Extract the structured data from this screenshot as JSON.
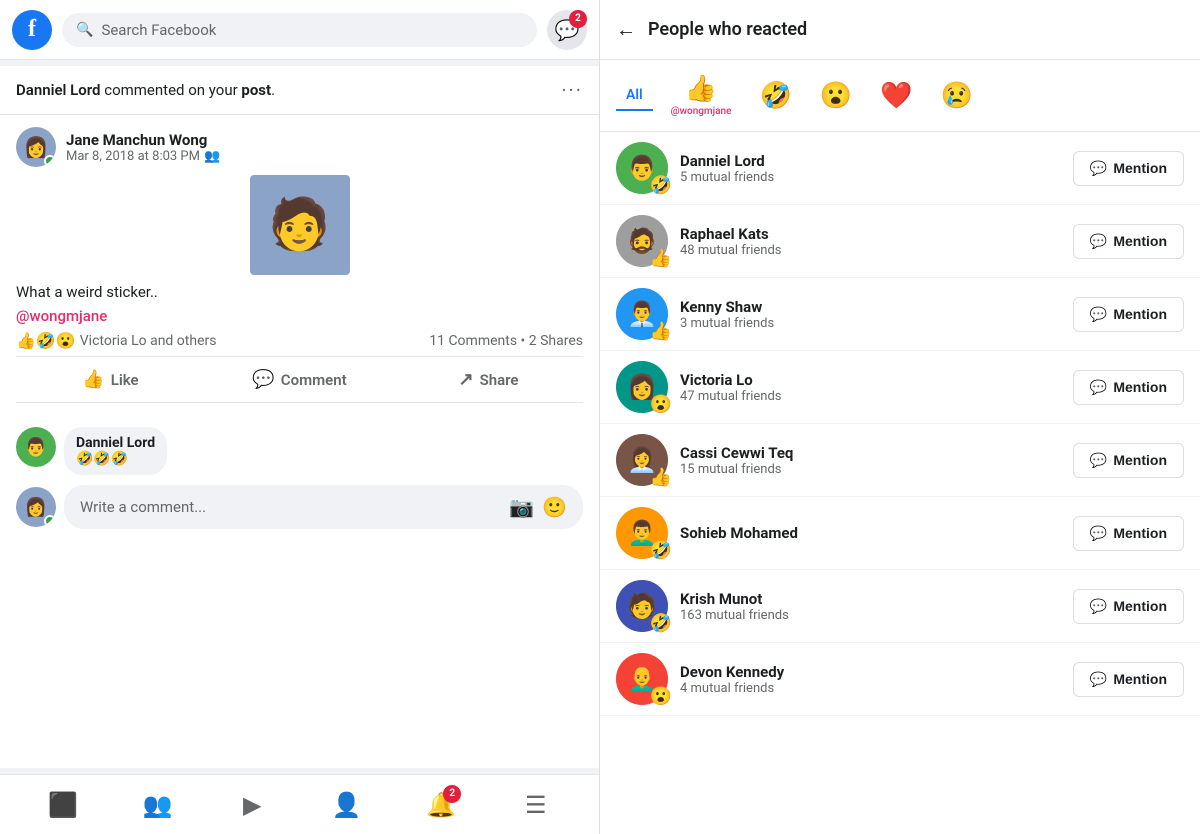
{
  "header": {
    "search_placeholder": "Search Facebook",
    "messenger_badge": "2",
    "fb_logo": "f"
  },
  "notification": {
    "text_prefix": "",
    "name": "Danniel Lord",
    "text_middle": " commented on your ",
    "text_bold": "post",
    "text_suffix": "."
  },
  "post": {
    "author": "Jane Manchun Wong",
    "date": "Mar 8, 2018 at 8:03 PM",
    "privacy_icon": "👥",
    "text": "What a weird sticker..",
    "mention": "@wongmjane",
    "reactions_label": "Victoria Lo and others",
    "comments_count": "11 Comments",
    "shares_count": "2 Shares",
    "like_label": "Like",
    "comment_label": "Comment",
    "share_label": "Share"
  },
  "comment": {
    "author": "Danniel Lord",
    "text": "🤣🤣🤣",
    "input_placeholder": "Write a comment..."
  },
  "bottom_nav": {
    "items": [
      "🏠",
      "👥",
      "▶",
      "👤",
      "🔔",
      "☰"
    ]
  },
  "right_panel": {
    "title": "People who reacted",
    "tabs": [
      {
        "label": "All",
        "emoji": "",
        "subtext": ""
      },
      {
        "label": "",
        "emoji": "👍",
        "subtext": "@wongmjane"
      },
      {
        "label": "",
        "emoji": "🤣",
        "subtext": ""
      },
      {
        "label": "",
        "emoji": "😮",
        "subtext": ""
      },
      {
        "label": "",
        "emoji": "❤️",
        "subtext": ""
      },
      {
        "label": "",
        "emoji": "😢",
        "subtext": ""
      }
    ],
    "people": [
      {
        "name": "Danniel Lord",
        "mutual": "5 mutual friends",
        "reaction": "🤣",
        "avatar_color": "av-green"
      },
      {
        "name": "Raphael Kats",
        "mutual": "48 mutual friends",
        "reaction": "👍",
        "avatar_color": "av-gray"
      },
      {
        "name": "Kenny Shaw",
        "mutual": "3 mutual friends",
        "reaction": "👍",
        "avatar_color": "av-blue"
      },
      {
        "name": "Victoria Lo",
        "mutual": "47 mutual friends",
        "reaction": "😮",
        "avatar_color": "av-teal"
      },
      {
        "name": "Cassi Cewwi Teq",
        "mutual": "15 mutual friends",
        "reaction": "👍",
        "avatar_color": "av-brown"
      },
      {
        "name": "Sohieb Mohamed",
        "mutual": "",
        "reaction": "🤣",
        "avatar_color": "av-orange"
      },
      {
        "name": "Krish Munot",
        "mutual": "163 mutual friends",
        "reaction": "🤣",
        "avatar_color": "av-indigo"
      },
      {
        "name": "Devon Kennedy",
        "mutual": "4 mutual friends",
        "reaction": "😮",
        "avatar_color": "av-red"
      }
    ],
    "mention_label": "Mention"
  }
}
